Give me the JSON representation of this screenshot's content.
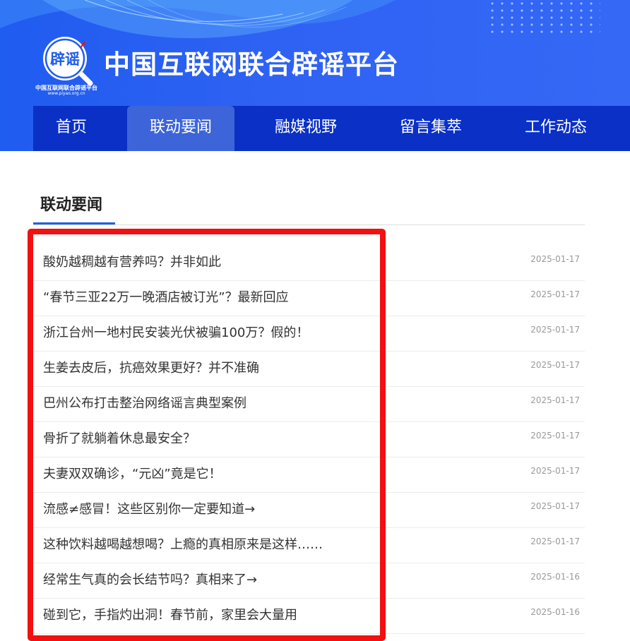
{
  "header": {
    "logo_badge_text": "辟谣",
    "logo_caption": "中国互联网联合辟谣平台",
    "logo_url": "www.piyao.org.cn",
    "site_title": "中国互联网联合辟谣平台",
    "brand_color": "#2f62f3",
    "nav_color": "#0b30c6"
  },
  "nav": {
    "items": [
      {
        "label": "首页",
        "active": false
      },
      {
        "label": "联动要闻",
        "active": true
      },
      {
        "label": "融媒视野",
        "active": false
      },
      {
        "label": "留言集萃",
        "active": false
      },
      {
        "label": "工作动态",
        "active": false
      }
    ]
  },
  "section": {
    "title": "联动要闻",
    "accent_color": "#1f60e6"
  },
  "news": [
    {
      "title": "酸奶越稠越有营养吗？并非如此",
      "date": "2025-01-17"
    },
    {
      "title": "“春节三亚22万一晚酒店被订光”？最新回应",
      "date": "2025-01-17"
    },
    {
      "title": "浙江台州一地村民安装光伏被骗100万？假的！",
      "date": "2025-01-17"
    },
    {
      "title": "生姜去皮后，抗癌效果更好？并不准确",
      "date": "2025-01-17"
    },
    {
      "title": "巴州公布打击整治网络谣言典型案例",
      "date": "2025-01-17"
    },
    {
      "title": "骨折了就躺着休息最安全？",
      "date": "2025-01-17"
    },
    {
      "title": "夫妻双双确诊，“元凶”竟是它！",
      "date": "2025-01-17"
    },
    {
      "title": "流感≠感冒！这些区别你一定要知道→",
      "date": "2025-01-17"
    },
    {
      "title": "这种饮料越喝越想喝？上瘾的真相原来是这样……",
      "date": "2025-01-17"
    },
    {
      "title": "经常生气真的会长结节吗？真相来了→",
      "date": "2025-01-16"
    },
    {
      "title": "碰到它，手指灼出洞！春节前，家里会大量用",
      "date": "2025-01-16"
    }
  ],
  "highlight": {
    "color": "#f21010"
  }
}
